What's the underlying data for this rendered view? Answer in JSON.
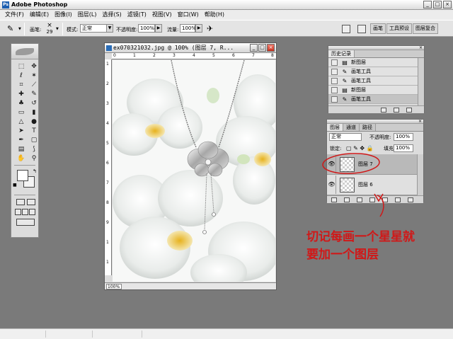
{
  "app": {
    "title": "Adobe Photoshop",
    "icon_name": "photoshop-icon"
  },
  "window_controls": {
    "minimize": "_",
    "maximize": "□",
    "close": "×"
  },
  "menu": [
    "文件(F)",
    "编辑(E)",
    "图像(I)",
    "图层(L)",
    "选择(S)",
    "滤镜(T)",
    "视图(V)",
    "窗口(W)",
    "帮助(H)"
  ],
  "options": {
    "brush_label": "画笔:",
    "brush_size": "29",
    "mode_label": "模式:",
    "mode_value": "正常",
    "opacity_label": "不透明度:",
    "opacity_value": "100%",
    "flow_label": "流量:",
    "flow_value": "100%",
    "wells": [
      "画笔",
      "工具预设",
      "图层复合"
    ]
  },
  "document": {
    "title": "ex070321032.jpg @ 100% (图层 7, R...",
    "ruler_top": [
      "0",
      "1",
      "2",
      "3",
      "4",
      "5",
      "6",
      "7",
      "8"
    ],
    "ruler_left": [
      "1",
      "2",
      "3",
      "4",
      "5",
      "6",
      "7",
      "8",
      "9",
      "1",
      "1"
    ],
    "zoom": "100%"
  },
  "history": {
    "tab": "历史记录",
    "rows": [
      {
        "label": "新图层",
        "icon": "new-layer-icon"
      },
      {
        "label": "画笔工具",
        "icon": "brush-icon"
      },
      {
        "label": "画笔工具",
        "icon": "brush-icon"
      },
      {
        "label": "新图层",
        "icon": "new-layer-icon"
      },
      {
        "label": "画笔工具",
        "icon": "brush-icon"
      }
    ]
  },
  "layers": {
    "tabs": [
      "图层",
      "通道",
      "路径"
    ],
    "blend_mode": "正常",
    "opacity_label": "不透明度:",
    "opacity_value": "100%",
    "lock_label": "锁定:",
    "fill_label": "填充:",
    "fill_value": "100%",
    "rows": [
      {
        "name": "图层 7",
        "selected": true
      },
      {
        "name": "图层 6",
        "selected": false
      }
    ]
  },
  "annotation": {
    "line1": "切记每画一个星星就",
    "line2": "要加一个图层",
    "color": "#d01818"
  }
}
